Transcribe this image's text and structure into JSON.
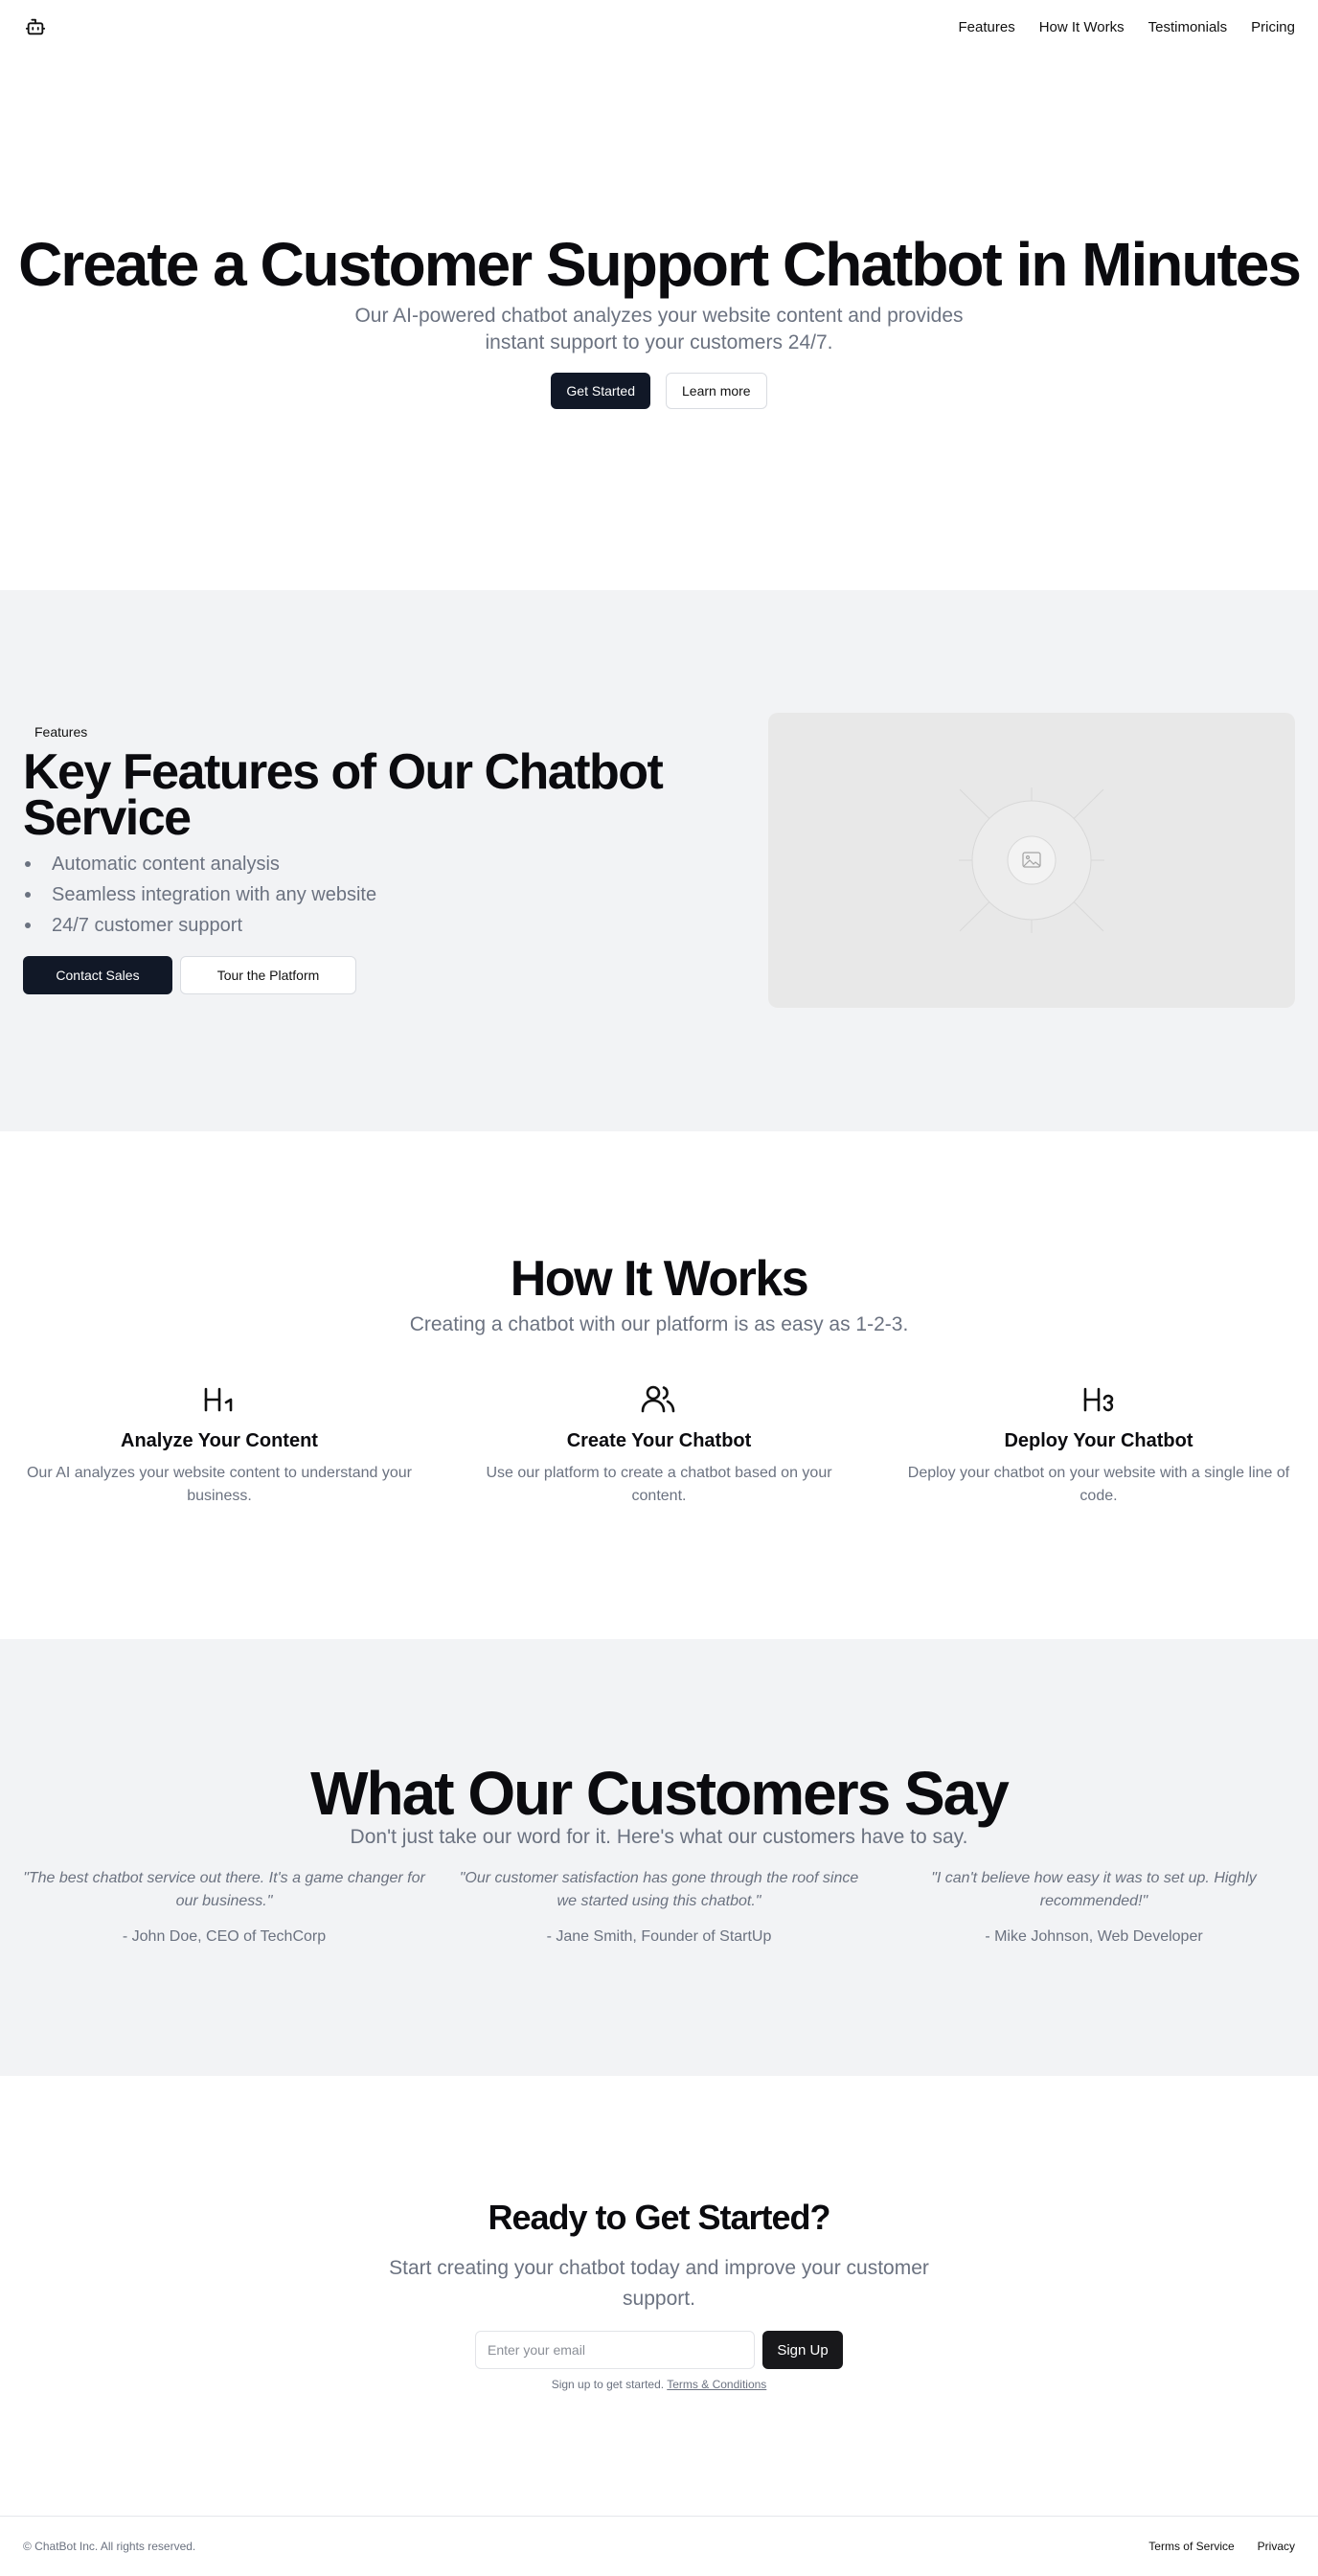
{
  "header": {
    "logo_icon": "bot-icon",
    "nav": [
      "Features",
      "How It Works",
      "Testimonials",
      "Pricing"
    ]
  },
  "hero": {
    "title": "Create a Customer Support Chatbot in Minutes",
    "subtitle": "Our AI-powered chatbot analyzes your website content and provides instant support to your customers 24/7.",
    "primary_button": "Get Started",
    "secondary_button": "Learn more"
  },
  "features": {
    "badge": "Features",
    "title": "Key Features of Our Chatbot Service",
    "items": [
      "Automatic content analysis",
      "Seamless integration with any website",
      "24/7 customer support"
    ],
    "primary_button": "Contact Sales",
    "secondary_button": "Tour the Platform",
    "image_icon": "image-placeholder-icon"
  },
  "how": {
    "title": "How It Works",
    "subtitle": "Creating a chatbot with our platform is as easy as 1-2-3.",
    "steps": [
      {
        "icon": "heading-1-icon",
        "title": "Analyze Your Content",
        "text": "Our AI analyzes your website content to understand your business."
      },
      {
        "icon": "users-icon",
        "title": "Create Your Chatbot",
        "text": "Use our platform to create a chatbot based on your content."
      },
      {
        "icon": "heading-3-icon",
        "title": "Deploy Your Chatbot",
        "text": "Deploy your chatbot on your website with a single line of code."
      }
    ]
  },
  "testimonials": {
    "title": "What Our Customers Say",
    "subtitle": "Don't just take our word for it. Here's what our customers have to say.",
    "items": [
      {
        "quote": "\"The best chatbot service out there. It's a game changer for our business.\"",
        "author": "- John Doe, CEO of TechCorp"
      },
      {
        "quote": "\"Our customer satisfaction has gone through the roof since we started using this chatbot.\"",
        "author": "- Jane Smith, Founder of StartUp"
      },
      {
        "quote": "\"I can't believe how easy it was to set up. Highly recommended!\"",
        "author": "- Mike Johnson, Web Developer"
      }
    ]
  },
  "cta": {
    "title": "Ready to Get Started?",
    "subtitle": "Start creating your chatbot today and improve your customer support.",
    "email_placeholder": "Enter your email",
    "button": "Sign Up",
    "legal_text": "Sign up to get started.",
    "legal_link": "Terms & Conditions"
  },
  "footer": {
    "copyright": "© ChatBot Inc. All rights reserved.",
    "links": [
      "Terms of Service",
      "Privacy"
    ]
  }
}
